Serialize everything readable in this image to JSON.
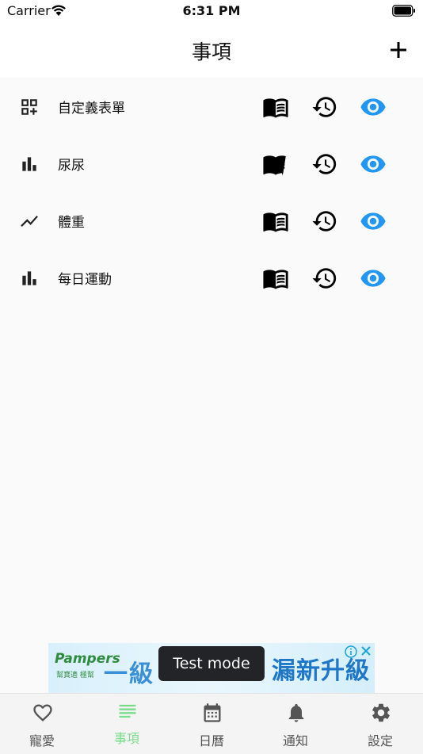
{
  "status_bar": {
    "carrier": "Carrier",
    "time": "6:31 PM"
  },
  "nav": {
    "title": "事項",
    "add_icon": "plus-icon"
  },
  "items": [
    {
      "label": "自定義表單",
      "icon": "qr-add-icon"
    },
    {
      "label": "尿尿",
      "icon": "bar-chart-icon"
    },
    {
      "label": "體重",
      "icon": "trend-line-icon"
    },
    {
      "label": "每日運動",
      "icon": "bar-chart-icon"
    }
  ],
  "row_actions": [
    "book-icon",
    "history-icon",
    "eye-icon"
  ],
  "ad": {
    "brand": "Pampers",
    "brand_sub": "幫寶適 極幫",
    "headline_left": "一級",
    "headline_right": "漏新升級",
    "toast": "Test mode"
  },
  "tabs": [
    {
      "label": "寵愛",
      "icon": "heart-icon",
      "active": false
    },
    {
      "label": "事項",
      "icon": "list-icon",
      "active": true
    },
    {
      "label": "日曆",
      "icon": "calendar-icon",
      "active": false
    },
    {
      "label": "通知",
      "icon": "bell-icon",
      "active": false
    },
    {
      "label": "設定",
      "icon": "gear-icon",
      "active": false
    }
  ],
  "colors": {
    "accent_eye": "#2196f3",
    "tab_active": "#7bdc8c",
    "tab_inactive": "#555555",
    "background": "#fafafa"
  }
}
